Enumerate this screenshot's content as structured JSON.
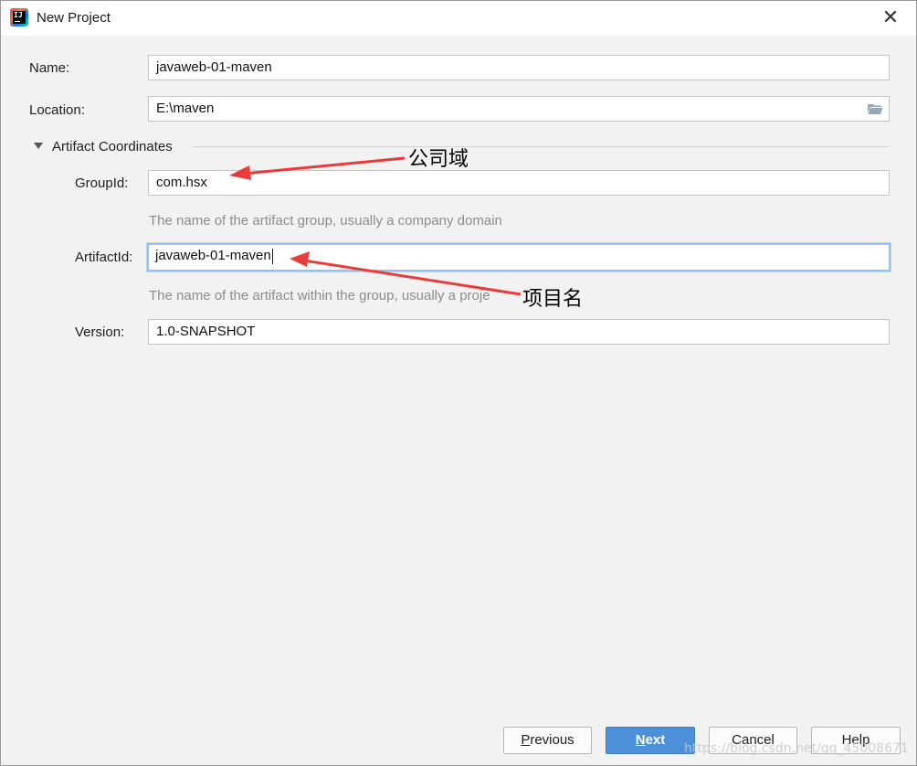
{
  "window": {
    "title": "New Project",
    "close_glyph": "✕"
  },
  "form": {
    "name": {
      "label": "Name:",
      "value": "javaweb-01-maven"
    },
    "location": {
      "label": "Location:",
      "value": "E:\\maven"
    },
    "section": {
      "label": "Artifact Coordinates"
    },
    "group_id": {
      "label": "GroupId:",
      "value": "com.hsx",
      "hint": "The name of the artifact group, usually a company domain"
    },
    "artifact_id": {
      "label": "ArtifactId:",
      "value": "javaweb-01-maven",
      "hint": "The name of the artifact within the group, usually a proje"
    },
    "version": {
      "label": "Version:",
      "value": "1.0-SNAPSHOT"
    }
  },
  "annotations": {
    "group_note": "公司域",
    "artifact_note": "项目名",
    "arrow_color": "#ea3b3b"
  },
  "buttons": {
    "previous": {
      "mnemonic": "P",
      "rest": "revious"
    },
    "next": {
      "mnemonic": "N",
      "rest": "ext"
    },
    "cancel": "Cancel",
    "help": "Help"
  },
  "watermark": "https://blog.csdn.net/qq_45008671",
  "icons": {
    "app": "intellij-idea-icon",
    "folder": "folder-open-icon",
    "section_toggle": "triangle-down-icon"
  }
}
